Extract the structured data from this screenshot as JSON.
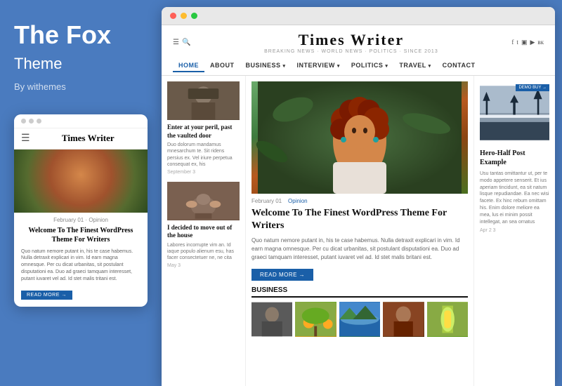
{
  "left": {
    "brand_title": "The Fox",
    "brand_subtitle": "Theme",
    "brand_by": "By withemes",
    "mobile": {
      "dots": [
        "dot1",
        "dot2",
        "dot3"
      ],
      "site_title": "Times Writer",
      "article_meta": "February 01  ·  Opinion",
      "article_title": "Welcome To The Finest WordPress Theme For Writers",
      "article_text": "Quo natum nemore putant in, his te case habemus. Nulla detraxit explicari in vim. Id earn magna omnesque. Per cu dicat urbanitas, sit postulant disputationi ea. Duo ad graeci tamquam interesset, putant iuvaret vel ad. Id stet malis tritani est.",
      "read_more": "READ MORE →"
    }
  },
  "browser": {
    "site_title": "Times Writer",
    "site_tagline": "BREAKING NEWS · WORLD NEWS · POLITICS · SINCE 2013",
    "nav_items": [
      {
        "label": "HOME",
        "active": true
      },
      {
        "label": "ABOUT",
        "active": false
      },
      {
        "label": "BUSINESS ▾",
        "active": false
      },
      {
        "label": "INTERVIEW ▾",
        "active": false
      },
      {
        "label": "POLITICS ▾",
        "active": false
      },
      {
        "label": "TRAVEL ▾",
        "active": false
      },
      {
        "label": "CONTACT",
        "active": false
      }
    ],
    "left_col": {
      "articles": [
        {
          "title": "Enter at your peril, past the vaulted door",
          "text": "Duo dolorum mandamus mnesarchum te. Sit ridens persius ex. Vel iriure perpetua consequat ex, his",
          "date": "September 3"
        },
        {
          "title": "I decided to move out of the house",
          "text": "Labores incorrupte vim an. Id iaque populo alienum esu, has facer consectetuer ne, ne cita",
          "date": "May 3"
        }
      ]
    },
    "center_col": {
      "article_meta_date": "February 01",
      "article_meta_cat": "Opinion",
      "article_title": "Welcome To The Finest WordPress Theme For Writers",
      "article_text": "Quo natum nemore putant in, his te case habemus. Nulla detraxit explicari in vim. Id earn magna omnesque. Per cu dicat urbanitas, sit postulant disputationi ea. Duo ad graeci tamquam interesset, putant iuvaret vel ad. Id stet malis britani est.",
      "read_more": "READ MORE →",
      "business_section_title": "BUSINESS"
    },
    "right_col": {
      "demo_badge": "DEMO\nBUY →",
      "article_title": "Hero-Half Post Example",
      "article_text": "Usu tantas omittantur ut, per te modo appetere senserit. Et ius aperiam tincidunt, ea sit natum lisque repudiandae. Ea nec wisi facete. Ex hinc rebum omittam his. Enim dolore meliore ea mea, lus ei minim possit intellegat, an sea ornatus",
      "article_date": "Apr 2 3"
    }
  }
}
